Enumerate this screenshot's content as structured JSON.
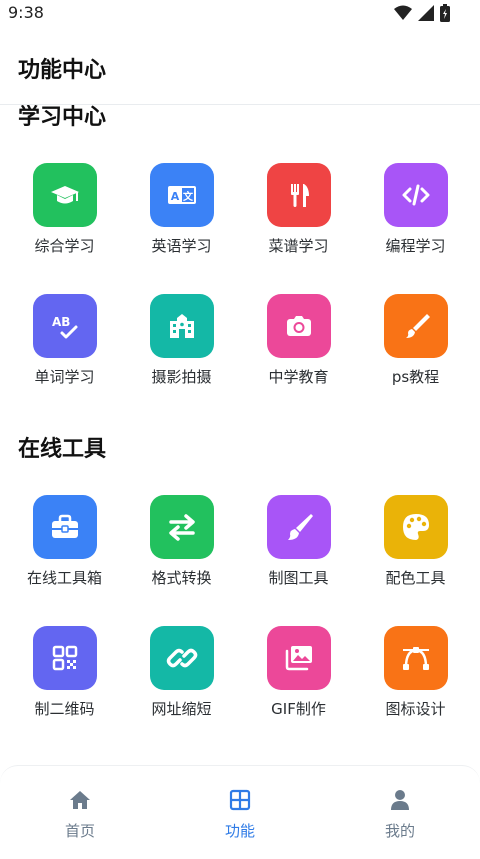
{
  "status": {
    "time": "9:38"
  },
  "header": {
    "title": "功能中心"
  },
  "colors": {
    "green": "#22c15e",
    "blue": "#3b82f6",
    "red": "#ef4444",
    "purple": "#a855f7",
    "indigo": "#6366f1",
    "teal": "#14b8a6",
    "pink": "#ec4899",
    "orange": "#f97316",
    "amber": "#eab308",
    "nav_active": "#2f7be6",
    "nav_inactive": "#6b7b8c"
  },
  "sections": {
    "learning": {
      "title": "学习中心",
      "items": [
        {
          "label": "综合学习",
          "icon": "graduation-cap-icon"
        },
        {
          "label": "英语学习",
          "icon": "language-icon"
        },
        {
          "label": "菜谱学习",
          "icon": "utensils-icon"
        },
        {
          "label": "编程学习",
          "icon": "code-icon"
        },
        {
          "label": "单词学习",
          "icon": "spellcheck-icon"
        },
        {
          "label": "摄影拍摄",
          "icon": "building-icon"
        },
        {
          "label": "中学教育",
          "icon": "camera-icon"
        },
        {
          "label": "ps教程",
          "icon": "brush-icon"
        }
      ]
    },
    "tools": {
      "title": "在线工具",
      "items": [
        {
          "label": "在线工具箱",
          "icon": "toolbox-icon"
        },
        {
          "label": "格式转换",
          "icon": "exchange-icon"
        },
        {
          "label": "制图工具",
          "icon": "paintbrush-icon"
        },
        {
          "label": "配色工具",
          "icon": "palette-icon"
        },
        {
          "label": "制二维码",
          "icon": "qrcode-icon"
        },
        {
          "label": "网址缩短",
          "icon": "link-icon"
        },
        {
          "label": "GIF制作",
          "icon": "images-icon"
        },
        {
          "label": "图标设计",
          "icon": "bezier-icon"
        }
      ]
    }
  },
  "nav": {
    "home": "首页",
    "features": "功能",
    "mine": "我的"
  }
}
